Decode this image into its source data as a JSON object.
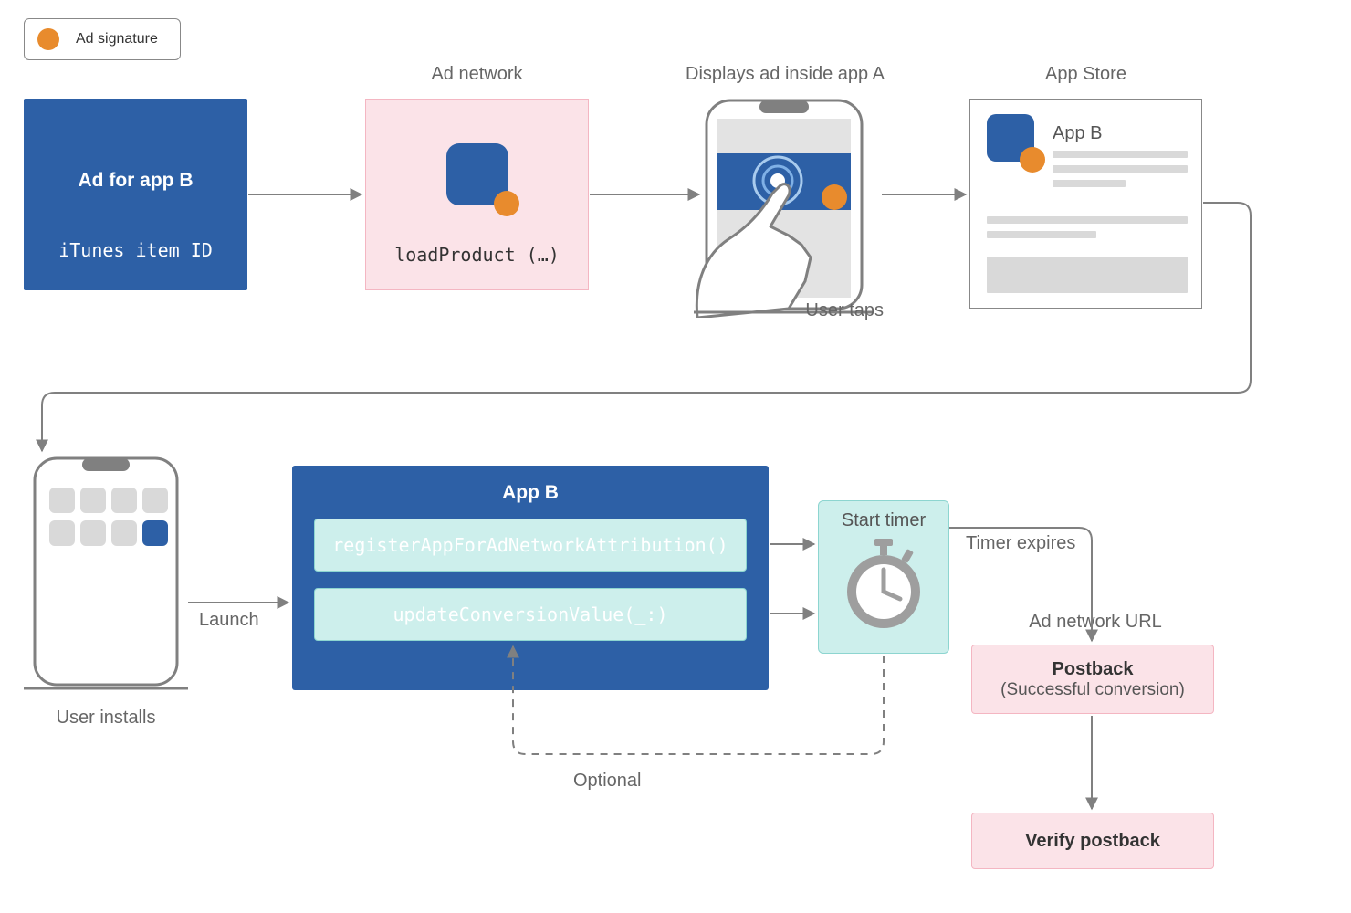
{
  "legend": {
    "label": "Ad signature"
  },
  "nodes": {
    "ad_for_app_b": {
      "title": "Ad for app B",
      "subtitle": "iTunes item ID"
    },
    "ad_network": {
      "label": "Ad network",
      "code": "loadProduct (…)"
    },
    "displays_ad": {
      "label": "Displays ad inside app A",
      "caption": "User taps"
    },
    "app_store": {
      "label": "App Store",
      "app_title": "App B"
    },
    "user_installs": {
      "caption": "User installs"
    },
    "launch": {
      "label": "Launch"
    },
    "app_b": {
      "title": "App B",
      "fn1": "registerAppForAdNetworkAttribution()",
      "fn2": "updateConversionValue(_:)"
    },
    "start_timer": {
      "label": "Start timer"
    },
    "timer_expires": {
      "label": "Timer expires"
    },
    "optional": {
      "label": "Optional"
    },
    "ad_network_url": {
      "label": "Ad network URL"
    },
    "postback": {
      "title": "Postback",
      "subtitle": "(Successful conversion)"
    },
    "verify": {
      "title": "Verify postback"
    }
  },
  "colors": {
    "blue": "#2D60A6",
    "pink": "#FBE3E8",
    "teal": "#CDEFEC",
    "orange": "#E88B2D",
    "grey": "#808080"
  }
}
